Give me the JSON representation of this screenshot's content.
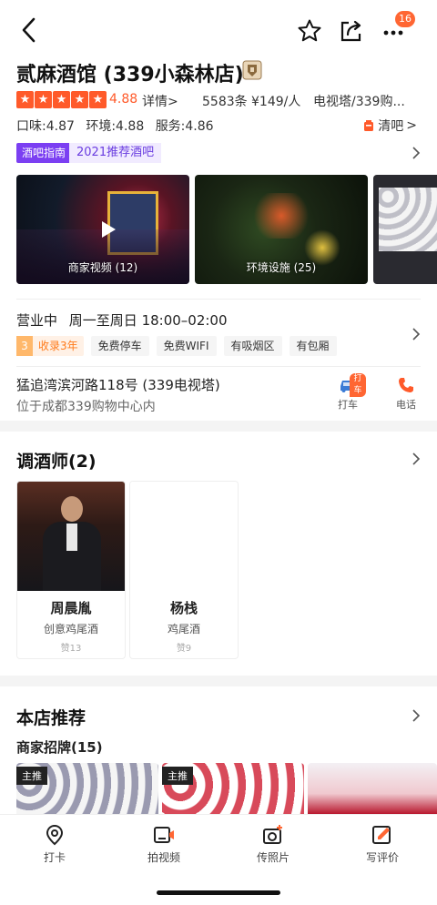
{
  "nav": {
    "badge_count": "16",
    "icons": [
      "back-arrow-icon",
      "star-icon",
      "share-icon",
      "more-icon"
    ]
  },
  "shop": {
    "name": "贰麻酒馆 (339小森林店)",
    "crest_icon": "shop-crest-icon"
  },
  "rating": {
    "stars": 5,
    "score": "4.88",
    "detail_label": "详情",
    "review_count": "5583条",
    "price_per_person": "¥149/人",
    "area": "电视塔/339购..."
  },
  "scores": {
    "taste": "口味:4.87",
    "environment": "环境:4.88",
    "service": "服务:4.86",
    "bar_type": "清吧"
  },
  "guide": {
    "tag": "酒吧指南",
    "rank": "2021推荐酒吧"
  },
  "gallery": [
    {
      "caption": "商家视频 (12)",
      "type": "video"
    },
    {
      "caption": "环境设施 (25)",
      "type": "photo"
    },
    {
      "caption": "",
      "type": "photo"
    }
  ],
  "hours": {
    "status": "营业中",
    "time": "周一至周日 18:00–02:00"
  },
  "tags": {
    "years_num": "3",
    "years_label": "收录3年",
    "items": [
      "免费停车",
      "免费WIFI",
      "有吸烟区",
      "有包厢"
    ]
  },
  "address": {
    "line1": "猛追湾滨河路118号 (339电视塔)",
    "line2": "位于成都339购物中心内",
    "taxi_label": "打车",
    "taxi_badge": "打车",
    "phone_label": "电话"
  },
  "bartenders": {
    "title": "调酒师(2)",
    "items": [
      {
        "name": "周晨胤",
        "specialty": "创意鸡尾酒",
        "likes": "赞13"
      },
      {
        "name": "杨栈",
        "specialty": "鸡尾酒",
        "likes": "赞9"
      }
    ]
  },
  "recommend": {
    "title": "本店推荐",
    "subtitle": "商家招牌(15)",
    "tiles": [
      {
        "tag": "主推"
      },
      {
        "tag": "主推"
      },
      {
        "tag": ""
      }
    ]
  },
  "bottom_bar": {
    "items": [
      {
        "label": "打卡",
        "icon": "location-pin-icon"
      },
      {
        "label": "拍视频",
        "icon": "video-camera-icon"
      },
      {
        "label": "传照片",
        "icon": "add-photo-icon"
      },
      {
        "label": "写评价",
        "icon": "edit-review-icon"
      }
    ]
  },
  "colors": {
    "accent": "#ff5a2a",
    "guide_purple": "#7b3ff2",
    "badge": "#ff6633"
  }
}
